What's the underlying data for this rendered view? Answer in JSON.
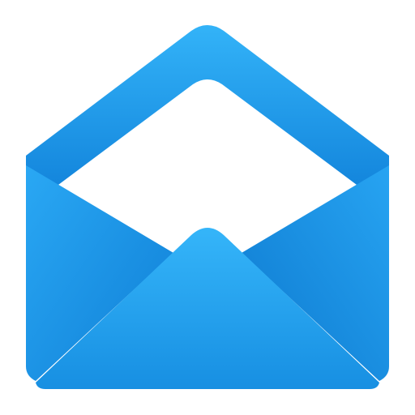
{
  "icon": {
    "name": "open-envelope-mail-icon",
    "colors": {
      "light_blue": "#33b3f8",
      "mid_blue": "#1e9be8",
      "dark_blue": "#0a78d0",
      "inner_white": "#ffffff"
    }
  }
}
